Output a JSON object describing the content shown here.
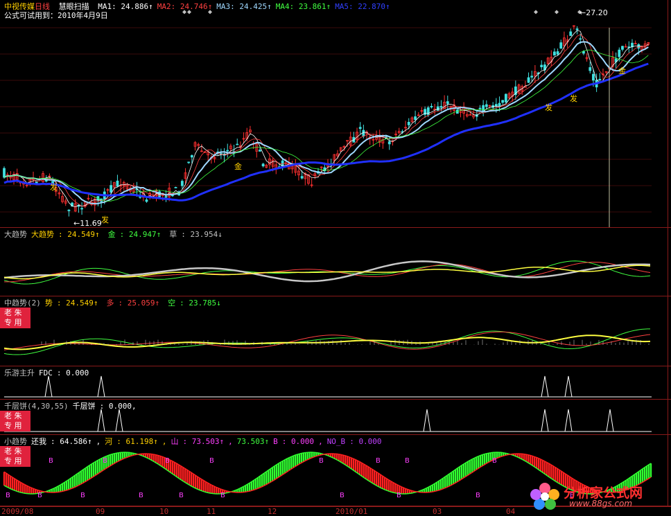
{
  "main": {
    "stock_name": "中视传媒",
    "period": "日线",
    "formula": "慧眼扫描",
    "ma": [
      {
        "label": "MA1",
        "value": "24.886↑",
        "color": "#ffffff"
      },
      {
        "label": "MA2",
        "value": "24.746↑",
        "color": "#ff4040"
      },
      {
        "label": "MA3",
        "value": "24.425↑",
        "color": "#9fd8ff"
      },
      {
        "label": "MA4",
        "value": "23.861↑",
        "color": "#40ff40"
      },
      {
        "label": "MA5",
        "value": "22.870↑",
        "color": "#3040ff"
      }
    ],
    "trial_notice": "公式可试用到：2010年4月9日",
    "high_label": "27.20",
    "low_label": "11.69",
    "signals": [
      "发",
      "发",
      "金",
      "发",
      "发",
      "金"
    ]
  },
  "trend": {
    "title": "大趋势",
    "name": "大趋势",
    "v1": "24.549↑",
    "jin_label": "金",
    "jin_value": "24.947↑",
    "cao_label": "草",
    "cao_value": "23.954↓"
  },
  "mid": {
    "title": "中趋势(2)",
    "shi_label": "势",
    "shi_value": "24.549↑",
    "duo_label": "多",
    "duo_value": "25.059↑",
    "kong_label": "空",
    "kong_value": "23.785↓",
    "badge": [
      "老",
      "朱",
      "专",
      "用"
    ]
  },
  "fdc": {
    "title": "乐游主升",
    "label": "FDC",
    "value": "0.000"
  },
  "qcb": {
    "title": "千层饼(4,30,55)",
    "label": "千层饼",
    "value": "0.000,",
    "badge": [
      "老",
      "朱",
      "专",
      "用"
    ]
  },
  "small": {
    "title": "小趋势",
    "huanwo_label": "还我",
    "huanwo_value": "64.586↑",
    "he_label": "河",
    "he_value": "61.198↑",
    "shan_label": "山",
    "shan_value": "73.503↑",
    "v4": "73.503↑",
    "b_label": "B",
    "b_value": "0.000",
    "nob_label": "NO_B",
    "nob_value": "0.000",
    "badge": [
      "老",
      "朱",
      "专",
      "用"
    ]
  },
  "xaxis": [
    "2009/08",
    "09",
    "10",
    "11",
    "12",
    "2010/01",
    "03",
    "04"
  ],
  "watermark": {
    "brand": "分析家公式网",
    "url": "www.88gs.com"
  }
}
